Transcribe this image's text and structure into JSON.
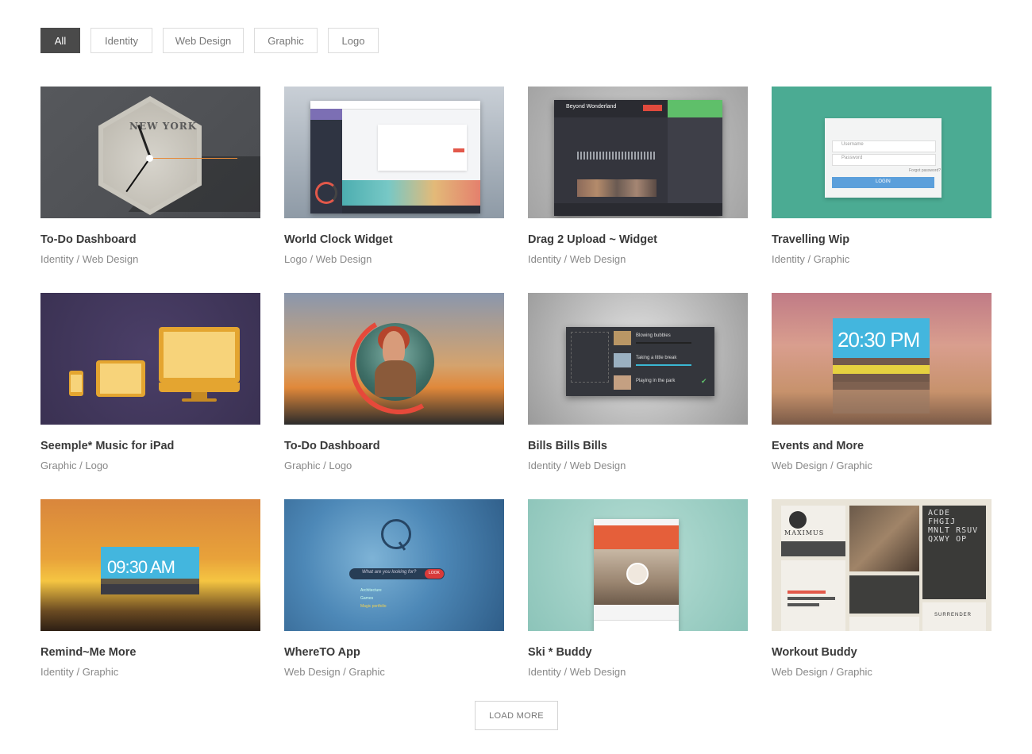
{
  "filters": [
    {
      "label": "All",
      "active": true
    },
    {
      "label": "Identity",
      "active": false
    },
    {
      "label": "Web Design",
      "active": false
    },
    {
      "label": "Graphic",
      "active": false
    },
    {
      "label": "Logo",
      "active": false
    }
  ],
  "portfolio": [
    {
      "title": "To-Do Dashboard",
      "categories": "Identity / Web Design"
    },
    {
      "title": "World Clock Widget",
      "categories": "Logo / Web Design"
    },
    {
      "title": "Drag 2 Upload ~ Widget",
      "categories": "Identity / Web Design"
    },
    {
      "title": "Travelling Wip",
      "categories": "Identity / Graphic"
    },
    {
      "title": "Seemple* Music for iPad",
      "categories": "Graphic / Logo"
    },
    {
      "title": "To-Do Dashboard",
      "categories": "Graphic / Logo"
    },
    {
      "title": "Bills Bills Bills",
      "categories": "Identity / Web Design"
    },
    {
      "title": "Events and More",
      "categories": "Web Design / Graphic"
    },
    {
      "title": "Remind~Me More",
      "categories": "Identity / Graphic"
    },
    {
      "title": "WhereTO App",
      "categories": "Web Design / Graphic"
    },
    {
      "title": "Ski * Buddy",
      "categories": "Identity / Web Design"
    },
    {
      "title": "Workout Buddy",
      "categories": "Web Design / Graphic"
    }
  ],
  "thumb_text": {
    "clock_city": "NEW YORK",
    "music_title": "Beyond Wonderland",
    "login_username": "Username",
    "login_password": "Password",
    "login_button": "LOGIN",
    "login_forgot": "Forgot password?",
    "bills_1": "Blowing bubbles",
    "bills_2": "Taking a little break",
    "bills_3": "Playing in the park",
    "events_time": "20:30 PM",
    "remind_time": "09:30 AM",
    "whereto_placeholder": "What are you looking for?",
    "whereto_button": "LOOK",
    "whereto_1": "Architecture",
    "whereto_2": "Games",
    "whereto_3": "Magic portfolio",
    "workout_brand": "MAXIMUS",
    "workout_alphabet": "ACDE FHGIJ MNLT RSUV QXWY OP",
    "workout_footer": "SURRENDER"
  },
  "load_more": "LOAD MORE"
}
